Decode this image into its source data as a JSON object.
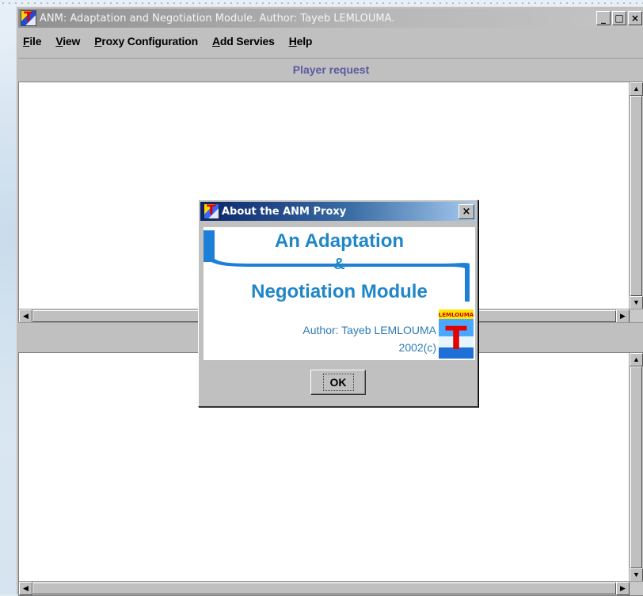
{
  "window": {
    "title": "ANM: Adaptation and Negotiation Module. Author: Tayeb LEMLOUMA.",
    "controls": {
      "minimize": "_",
      "maximize": "□",
      "close": "×"
    }
  },
  "menu": {
    "items": [
      {
        "hotkey": "F",
        "rest": "ile"
      },
      {
        "hotkey": "V",
        "rest": "iew"
      },
      {
        "hotkey": "P",
        "rest": "roxy Configuration"
      },
      {
        "hotkey": "A",
        "rest": "dd Servies"
      },
      {
        "hotkey": "H",
        "rest": "elp"
      }
    ]
  },
  "sections": {
    "top_header": "Player request"
  },
  "dialog": {
    "title": "About the ANM Proxy",
    "close": "×",
    "heading_line1": "An Adaptation",
    "heading_line2": "&",
    "heading_line3": "Negotiation Module",
    "author": "Author: Tayeb LEMLOUMA",
    "year": "2002(c)",
    "logo_text": "LEMLOUMA",
    "logo_letter": "T",
    "ok_label": "OK"
  },
  "colors": {
    "heading": "#1f86c8",
    "section_header_text": "#5a5aa0",
    "dialog_title_start": "#0a246a",
    "dialog_title_end": "#a6caf0"
  },
  "icons": {
    "app": "t-logo-icon",
    "scroll_up": "▲",
    "scroll_down": "▼",
    "scroll_left": "◀",
    "scroll_right": "▶"
  }
}
